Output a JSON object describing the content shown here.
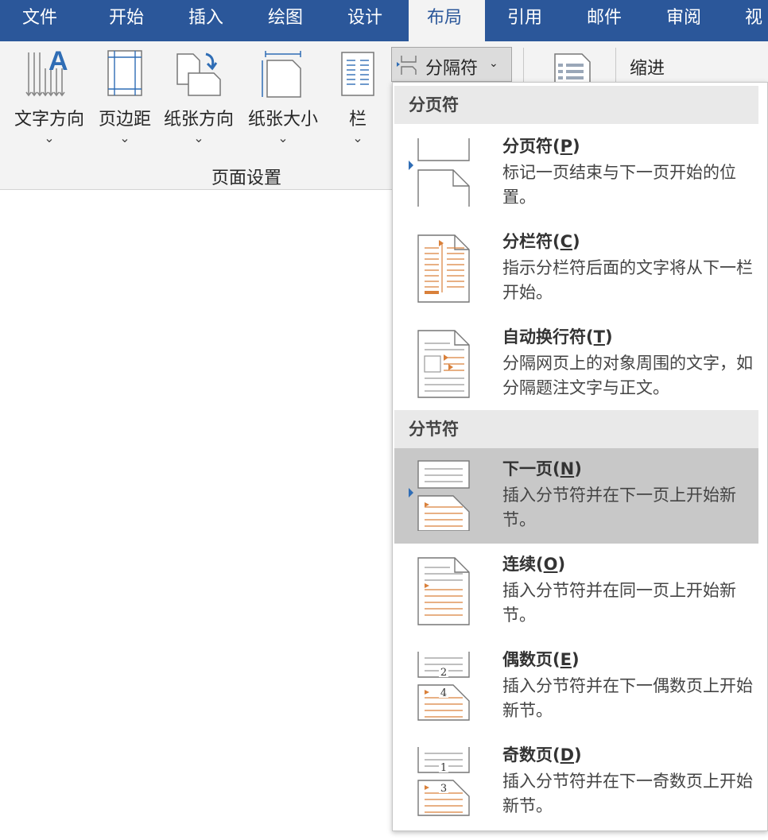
{
  "tabs": [
    {
      "label": "文件",
      "active": false
    },
    {
      "label": "开始",
      "active": false
    },
    {
      "label": "插入",
      "active": false
    },
    {
      "label": "绘图",
      "active": false
    },
    {
      "label": "设计",
      "active": false
    },
    {
      "label": "布局",
      "active": true
    },
    {
      "label": "引用",
      "active": false
    },
    {
      "label": "邮件",
      "active": false
    },
    {
      "label": "审阅",
      "active": false
    },
    {
      "label": "视",
      "active": false
    }
  ],
  "ribbon": {
    "text_direction": "文字方向",
    "margins": "页边距",
    "orientation": "纸张方向",
    "size": "纸张大小",
    "columns": "栏",
    "group_label": "页面设置",
    "breaks_label": "分隔符",
    "indent_label": "缩进",
    "chevron": "⌄"
  },
  "colors": {
    "tab_bar": "#2b579a",
    "accent_orange": "#d9803a",
    "selected_item": "#c8c8c8",
    "arrow_blue": "#2f6db5"
  },
  "dropdown": {
    "page_breaks_heading": "分页符",
    "section_breaks_heading": "分节符",
    "items": [
      {
        "title": "分页符",
        "mnemonic": "P",
        "desc": "标记一页结束与下一页开始的位置。",
        "icon": "page-break-icon"
      },
      {
        "title": "分栏符",
        "mnemonic": "C",
        "desc": "指示分栏符后面的文字将从下一栏开始。",
        "icon": "column-break-icon"
      },
      {
        "title": "自动换行符",
        "mnemonic": "T",
        "desc": "分隔网页上的对象周围的文字，如分隔题注文字与正文。",
        "icon": "text-wrapping-icon"
      },
      {
        "title": "下一页",
        "mnemonic": "N",
        "desc": "插入分节符并在下一页上开始新节。",
        "icon": "next-page-icon",
        "selected": true
      },
      {
        "title": "连续",
        "mnemonic": "O",
        "desc": "插入分节符并在同一页上开始新节。",
        "icon": "continuous-icon"
      },
      {
        "title": "偶数页",
        "mnemonic": "E",
        "desc": "插入分节符并在下一偶数页上开始新节。",
        "icon": "even-page-icon",
        "num_top": "2",
        "num_bottom": "4"
      },
      {
        "title": "奇数页",
        "mnemonic": "D",
        "desc": "插入分节符并在下一奇数页上开始新节。",
        "icon": "odd-page-icon",
        "num_top": "1",
        "num_bottom": "3"
      }
    ]
  }
}
